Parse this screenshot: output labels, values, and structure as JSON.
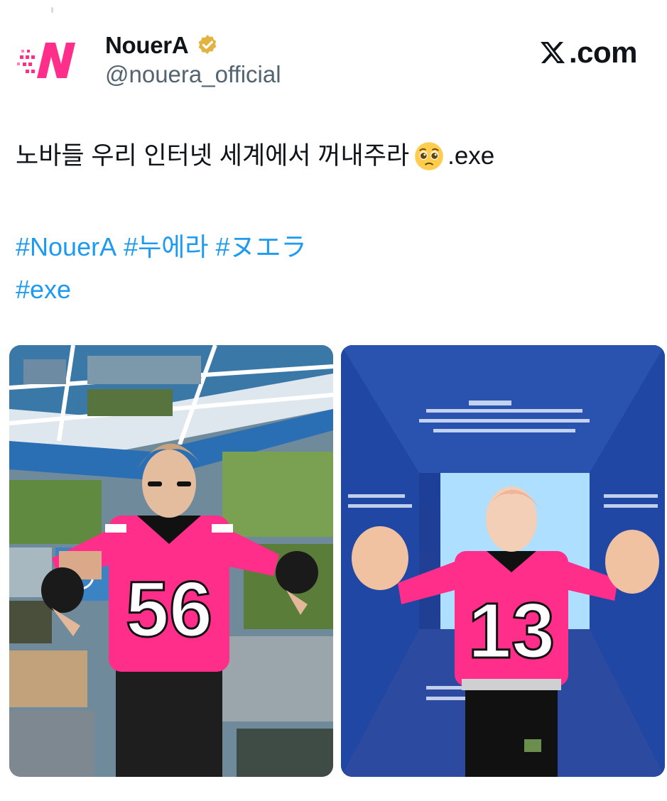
{
  "account": {
    "display_name": "NouerA",
    "handle": "@nouera_official",
    "avatar_icon": "nouera-logo-icon",
    "verified_icon": "verified-badge-icon",
    "verified_color": "#e3b341",
    "brand_color": "#ff2e8a"
  },
  "site": {
    "label": ".com",
    "icon": "x-logo-icon"
  },
  "tweet": {
    "text": "노바들 우리 인터넷 세계에서 꺼내주라",
    "emoji": "pleading-face-emoji",
    "suffix": ".exe",
    "hashtags_line1": [
      "#NouerA",
      "#누에라",
      "#ヌエラ"
    ],
    "hashtags_line2": [
      "#exe"
    ],
    "link_color": "#1d9bf0"
  },
  "media": {
    "photos": [
      {
        "subject": "person in pink #56 jersey in photo-covered booth",
        "jersey_number": "56"
      },
      {
        "subject": "person in pink #13 jersey in blue error-screen booth",
        "jersey_number": "13"
      }
    ]
  }
}
